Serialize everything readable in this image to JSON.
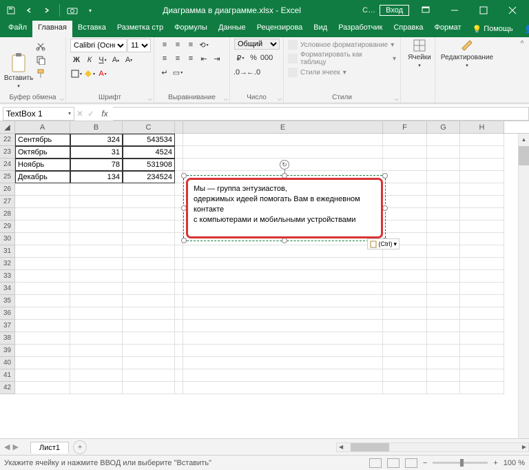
{
  "title": "Диаграмма в диаграмме.xlsx - Excel",
  "login": "Вход",
  "tabs": {
    "file": "Файл",
    "home": "Главная",
    "insert": "Вставка",
    "layout": "Разметка стр",
    "formulas": "Формулы",
    "data": "Данные",
    "review": "Рецензирова",
    "view": "Вид",
    "developer": "Разработчик",
    "help": "Справка",
    "format": "Формат",
    "tell": "Помощь",
    "share": "Поделиться"
  },
  "ribbon": {
    "clipboard": {
      "paste": "Вставить",
      "label": "Буфер обмена"
    },
    "font": {
      "name": "Calibri (Осно",
      "size": "11",
      "label": "Шрифт"
    },
    "alignment": {
      "label": "Выравнивание"
    },
    "number": {
      "format": "Общий",
      "label": "Число"
    },
    "styles": {
      "cond": "Условное форматирование",
      "table": "Форматировать как таблицу",
      "cell": "Стили ячеек",
      "label": "Стили"
    },
    "cells": {
      "btn": "Ячейки"
    },
    "editing": {
      "btn": "Редактирование"
    }
  },
  "namebox": "TextBox 1",
  "columns": [
    "A",
    "B",
    "C",
    "",
    "E",
    "F",
    "G",
    "H"
  ],
  "data_rows": [
    {
      "n": 22,
      "a": "Сентябрь",
      "b": "324",
      "c": "543534"
    },
    {
      "n": 23,
      "a": "Октябрь",
      "b": "31",
      "c": "4524"
    },
    {
      "n": 24,
      "a": "Ноябрь",
      "b": "78",
      "c": "531908"
    },
    {
      "n": 25,
      "a": "Декабрь",
      "b": "134",
      "c": "234524"
    }
  ],
  "empty_rows": [
    26,
    27,
    28,
    29,
    30,
    31,
    32,
    33,
    34,
    35,
    36,
    37,
    38,
    39,
    40,
    41,
    42
  ],
  "textbox": {
    "l1": "Мы — группа энтузиастов,",
    "l2": "одержимых идеей помогать Вам в ежедневном",
    "l3": "контакте",
    "l4": "с компьютерами и мобильными устройствами",
    "ctrl": "(Ctrl)"
  },
  "sheet": "Лист1",
  "status": "Укажите ячейку и нажмите ВВОД или выберите \"Вставить\"",
  "zoom": "100 %"
}
